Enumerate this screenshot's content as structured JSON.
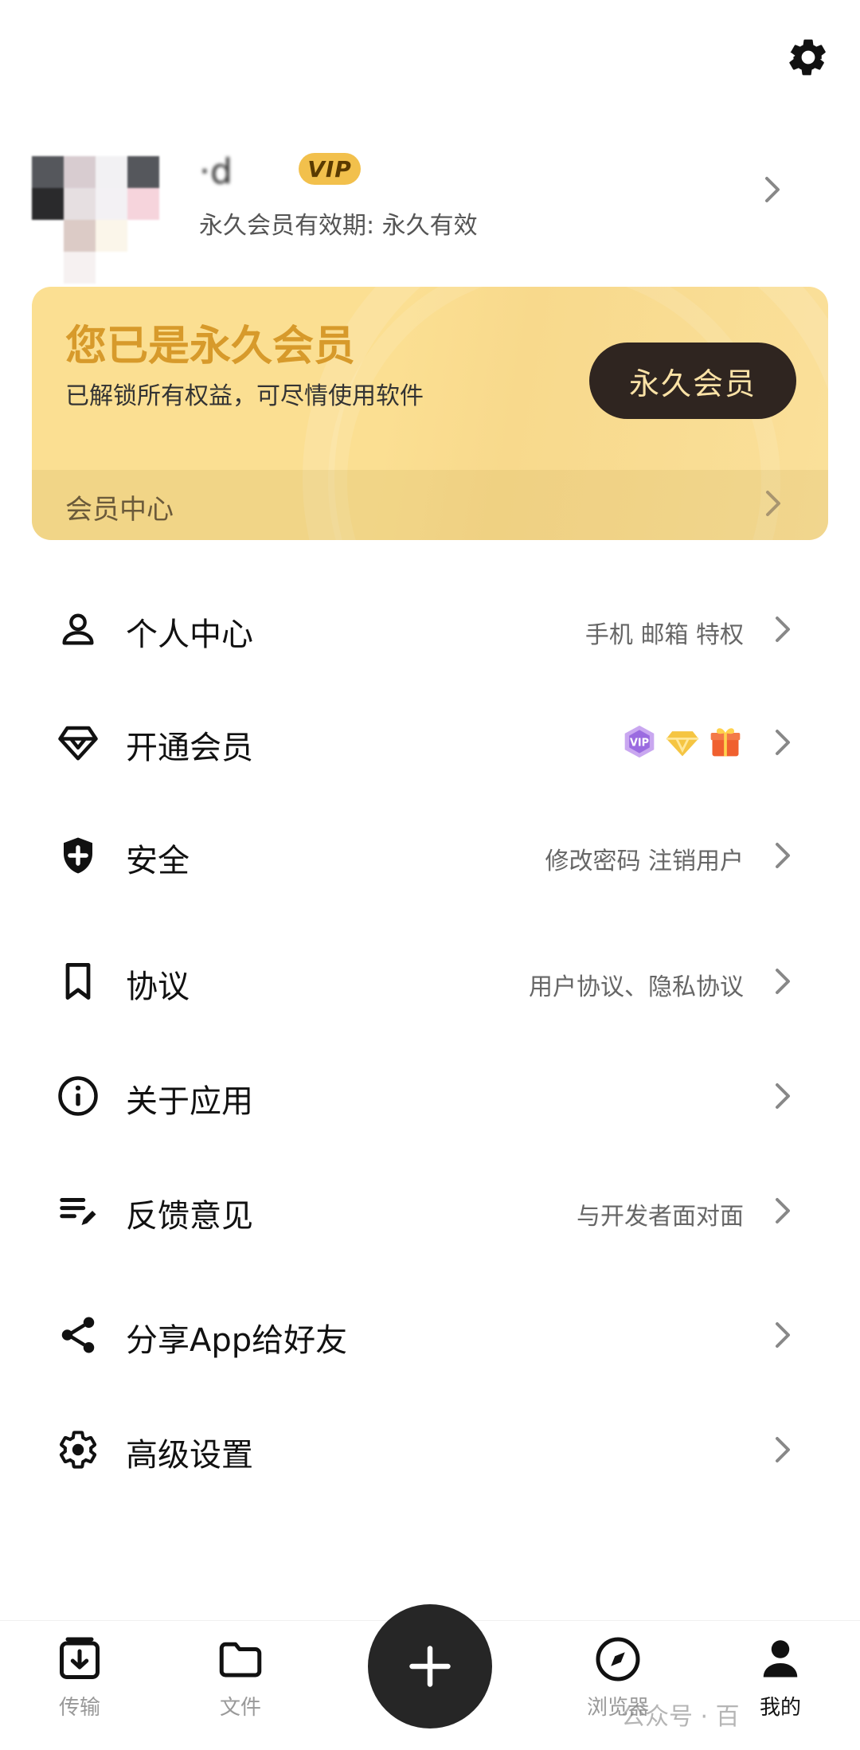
{
  "header": {
    "settings_icon": "gear-icon"
  },
  "profile": {
    "username": "·d",
    "vip_badge": "VIP",
    "validity": "永久会员有效期: 永久有效"
  },
  "vip_card": {
    "title": "您已是永久会员",
    "subtitle": "已解锁所有权益，可尽情使用软件",
    "button_label": "永久会员",
    "member_center_label": "会员中心",
    "colors": {
      "card_bg": "#fbdf92",
      "title": "#d79a2b",
      "button_bg": "#2f2520"
    }
  },
  "menu": {
    "items": [
      {
        "label": "个人中心",
        "detail": "手机 邮箱 特权",
        "icon": "person-icon"
      },
      {
        "label": "开通会员",
        "detail": "",
        "icon": "diamond-icon",
        "badges": [
          "vip-badge-icon",
          "gold-diamond-icon",
          "gift-icon"
        ]
      },
      {
        "label": "安全",
        "detail": "修改密码  注销用户",
        "icon": "shield-icon"
      },
      {
        "label": "协议",
        "detail": "用户协议、隐私协议",
        "icon": "bookmark-icon"
      },
      {
        "label": "关于应用",
        "detail": "",
        "icon": "info-icon"
      },
      {
        "label": "反馈意见",
        "detail": "与开发者面对面",
        "icon": "edit-list-icon"
      },
      {
        "label": "分享App给好友",
        "detail": "",
        "icon": "share-icon"
      },
      {
        "label": "高级设置",
        "detail": "",
        "icon": "gear-icon"
      }
    ]
  },
  "bottom_nav": {
    "tabs": [
      {
        "label": "传输",
        "icon": "transfer-icon",
        "active": false
      },
      {
        "label": "文件",
        "icon": "folder-icon",
        "active": false
      },
      {
        "label": "浏览器",
        "icon": "compass-icon",
        "active": false
      },
      {
        "label": "我的",
        "icon": "user-icon",
        "active": true
      }
    ],
    "fab_icon": "plus-icon"
  },
  "watermark": "公众号 · 百"
}
